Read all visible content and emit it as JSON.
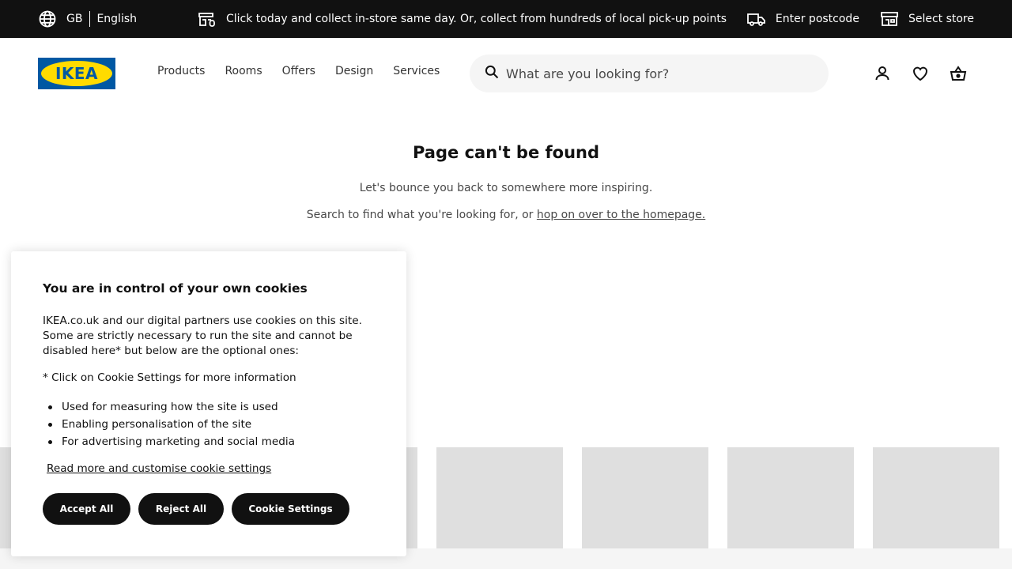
{
  "topbar": {
    "country": "GB",
    "language": "English",
    "promo": "Click today and collect in-store same day. Or, collect from hundreds of local pick-up points",
    "postcode": "Enter postcode",
    "store": "Select store"
  },
  "header": {
    "logo_text": "IKEA",
    "nav": [
      "Products",
      "Rooms",
      "Offers",
      "Design",
      "Services"
    ],
    "search_placeholder": "What are you looking for?"
  },
  "main": {
    "title": "Page can't be found",
    "line1": "Let's bounce you back to somewhere more inspiring.",
    "line2_prefix": "Search to find what you're looking for, or ",
    "line2_link": "hop on over to the homepage."
  },
  "cookie": {
    "title": "You are in control of your own cookies",
    "body": "IKEA.co.uk and our digital partners use cookies on this site. Some are strictly necessary to run the site and cannot be disabled here* but below are the optional ones:",
    "note": "* Click on Cookie Settings for more information",
    "items": [
      "Used for measuring how the site is used",
      "Enabling personalisation of the site",
      "For advertising marketing and social media"
    ],
    "read_more": "Read more and customise cookie settings",
    "accept": "Accept All",
    "reject": "Reject All",
    "settings": "Cookie Settings"
  },
  "colors": {
    "topbar_bg": "#111111",
    "logo_blue": "#0058a3",
    "logo_yellow": "#ffdb00",
    "tile_grey": "#dfdfdf",
    "button_bg": "#111111"
  },
  "icons": {
    "globe": "globe-icon",
    "store": "store-icon",
    "truck": "truck-icon",
    "search": "search-icon",
    "user": "user-icon",
    "heart": "heart-icon",
    "basket": "basket-icon"
  }
}
